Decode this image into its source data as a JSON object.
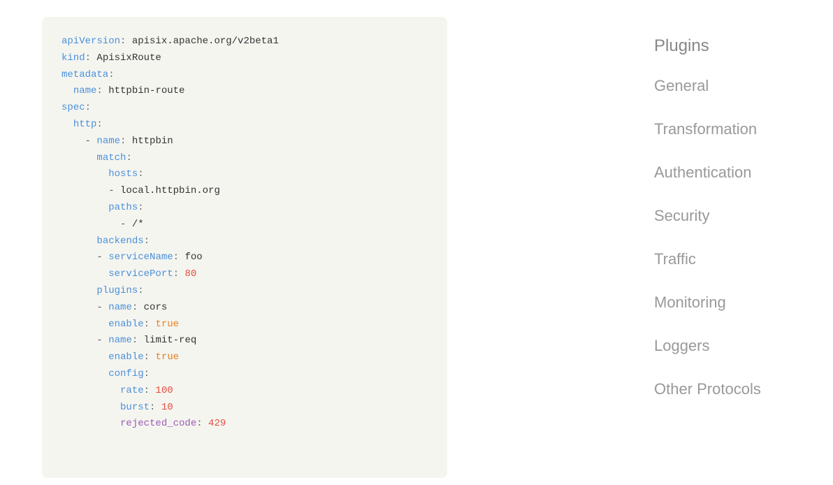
{
  "code": {
    "lines": [
      {
        "type": "key-value",
        "key": "apiVersion",
        "colon": ":",
        "value": " apisix.apache.org/v2beta1",
        "indent": 0
      },
      {
        "type": "key-value",
        "key": "kind",
        "colon": ":",
        "value": " ApisixRoute",
        "indent": 0
      },
      {
        "type": "key-only",
        "key": "metadata",
        "colon": ":",
        "indent": 0
      },
      {
        "type": "key-value",
        "key": "  name",
        "colon": ":",
        "value": " httpbin-route",
        "indent": 1
      },
      {
        "type": "key-only",
        "key": "spec",
        "colon": ":",
        "indent": 0
      },
      {
        "type": "key-only",
        "key": "  http",
        "colon": ":",
        "indent": 1
      },
      {
        "type": "dash-key-value",
        "dash": "  - ",
        "key": "name",
        "colon": ":",
        "value": " httpbin",
        "indent": 2
      },
      {
        "type": "key-only",
        "key": "    match",
        "colon": ":",
        "indent": 2
      },
      {
        "type": "key-only",
        "key": "      hosts",
        "colon": ":",
        "indent": 3
      },
      {
        "type": "dash-value",
        "dash": "      - ",
        "value": "local.httpbin.org",
        "indent": 3
      },
      {
        "type": "key-only",
        "key": "      paths",
        "colon": ":",
        "indent": 3
      },
      {
        "type": "dash-value",
        "dash": "        - ",
        "value": "/*",
        "indent": 4
      },
      {
        "type": "key-only",
        "key": "    backends",
        "colon": ":",
        "indent": 2
      },
      {
        "type": "dash-key-value",
        "dash": "    - ",
        "key": "serviceName",
        "colon": ":",
        "value": " foo",
        "indent": 3
      },
      {
        "type": "key-value",
        "key": "      servicePort",
        "colon": ":",
        "value": " 80",
        "valueType": "number",
        "indent": 3
      },
      {
        "type": "key-only",
        "key": "    plugins",
        "colon": ":",
        "indent": 2
      },
      {
        "type": "dash-key-value",
        "dash": "    - ",
        "key": "name",
        "colon": ":",
        "value": " cors",
        "indent": 3
      },
      {
        "type": "key-value-bool",
        "key": "      enable",
        "colon": ":",
        "value": " true",
        "indent": 3
      },
      {
        "type": "dash-key-value",
        "dash": "    - ",
        "key": "name",
        "colon": ":",
        "value": " limit-req",
        "indent": 3
      },
      {
        "type": "key-value-bool",
        "key": "      enable",
        "colon": ":",
        "value": " true",
        "indent": 3
      },
      {
        "type": "key-only",
        "key": "      config",
        "colon": ":",
        "indent": 3
      },
      {
        "type": "key-value",
        "key": "        rate",
        "colon": ":",
        "value": " 100",
        "valueType": "number",
        "indent": 4
      },
      {
        "type": "key-value",
        "key": "        burst",
        "colon": ":",
        "value": " 10",
        "valueType": "number",
        "indent": 4
      },
      {
        "type": "key-value",
        "key": "        rejected_code",
        "colon": ":",
        "value": " 429",
        "valueType": "number",
        "indent": 4
      }
    ]
  },
  "sidebar": {
    "header": "Plugins",
    "items": [
      {
        "label": "General",
        "id": "general"
      },
      {
        "label": "Transformation",
        "id": "transformation"
      },
      {
        "label": "Authentication",
        "id": "authentication"
      },
      {
        "label": "Security",
        "id": "security"
      },
      {
        "label": "Traffic",
        "id": "traffic"
      },
      {
        "label": "Monitoring",
        "id": "monitoring"
      },
      {
        "label": "Loggers",
        "id": "loggers"
      },
      {
        "label": "Other Protocols",
        "id": "other-protocols"
      }
    ]
  }
}
